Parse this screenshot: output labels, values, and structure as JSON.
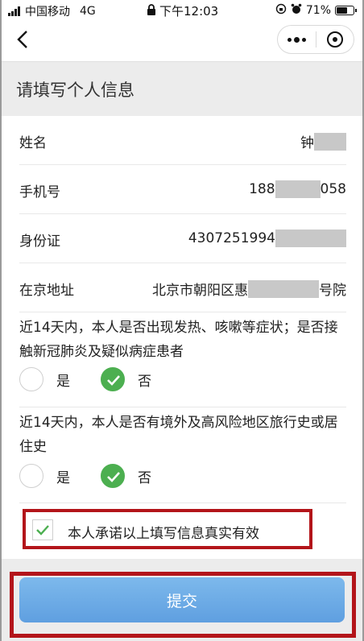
{
  "status_bar": {
    "carrier": "中国移动",
    "network": "4G",
    "time": "下午12:03",
    "battery_percent": "71%",
    "battery_level": 0.71
  },
  "nav": {
    "back_icon": "chevron-left-icon",
    "more_icon": "more-dots-icon",
    "close_icon": "target-circle-icon"
  },
  "section": {
    "title": "请填写个人信息"
  },
  "form": {
    "name": {
      "label": "姓名",
      "value": "钟"
    },
    "phone": {
      "label": "手机号",
      "value_prefix": "188",
      "value_suffix": "058"
    },
    "id_card": {
      "label": "身份证",
      "value": "4307251994"
    },
    "address": {
      "label": "在京地址",
      "value_prefix": "北京市朝阳区惠",
      "value_suffix": "号院"
    }
  },
  "questions": [
    {
      "text": "近14天内，本人是否出现发热、咳嗽等症状；是否接触新冠肺炎及疑似病症患者",
      "options": [
        "是",
        "否"
      ],
      "selected": "否"
    },
    {
      "text": "近14天内，本人是否有境外及高风险地区旅行史或居住史",
      "options": [
        "是",
        "否"
      ],
      "selected": "否"
    }
  ],
  "promise": {
    "text": "本人承诺以上填写信息真实有效",
    "checked": true
  },
  "submit": {
    "label": "提交"
  },
  "colors": {
    "accent_green": "#4caf50",
    "submit_blue": "#6aa8e6",
    "highlight_red": "#b3151a",
    "header_gray": "#ececec"
  }
}
